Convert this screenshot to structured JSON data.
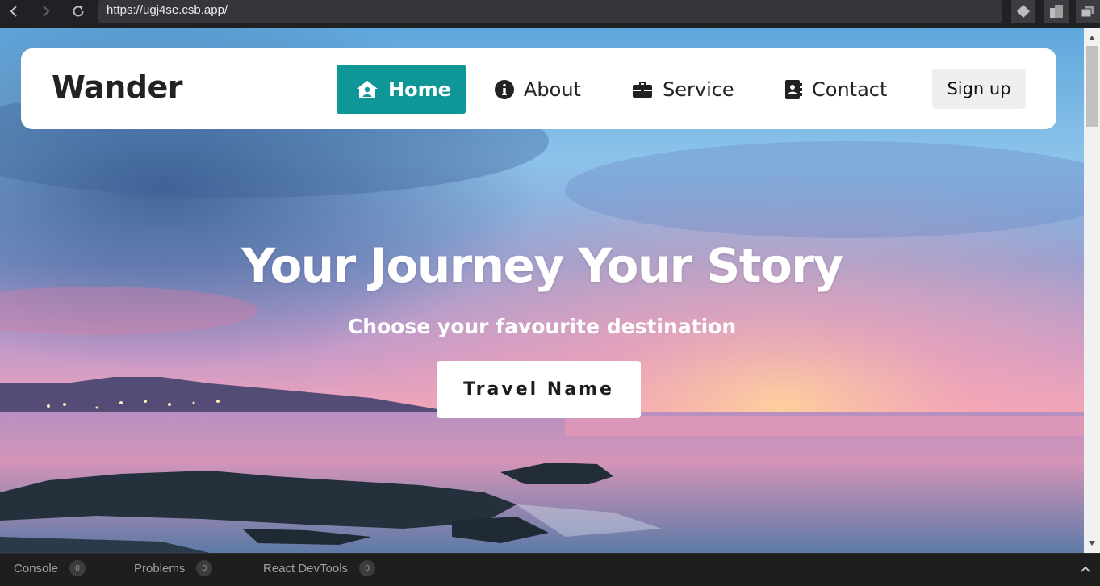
{
  "browser": {
    "url": "https://ugj4se.csb.app/"
  },
  "navbar": {
    "brand": "Wander",
    "items": [
      {
        "label": "Home",
        "icon": "home-user-icon",
        "active": true
      },
      {
        "label": "About",
        "icon": "info-circle-icon",
        "active": false
      },
      {
        "label": "Service",
        "icon": "briefcase-icon",
        "active": false
      },
      {
        "label": "Contact",
        "icon": "address-book-icon",
        "active": false
      }
    ],
    "signup_label": "Sign up"
  },
  "hero": {
    "title": "Your Journey Your Story",
    "subtitle": "Choose your favourite destination",
    "cta_label": "Travel Name"
  },
  "devtools": {
    "tabs": [
      {
        "label": "Console",
        "count": "0"
      },
      {
        "label": "Problems",
        "count": "0"
      },
      {
        "label": "React DevTools",
        "count": "0"
      }
    ]
  },
  "colors": {
    "accent": "#0f9696",
    "navbar_bg": "#ffffff",
    "signup_bg": "#efefef"
  }
}
